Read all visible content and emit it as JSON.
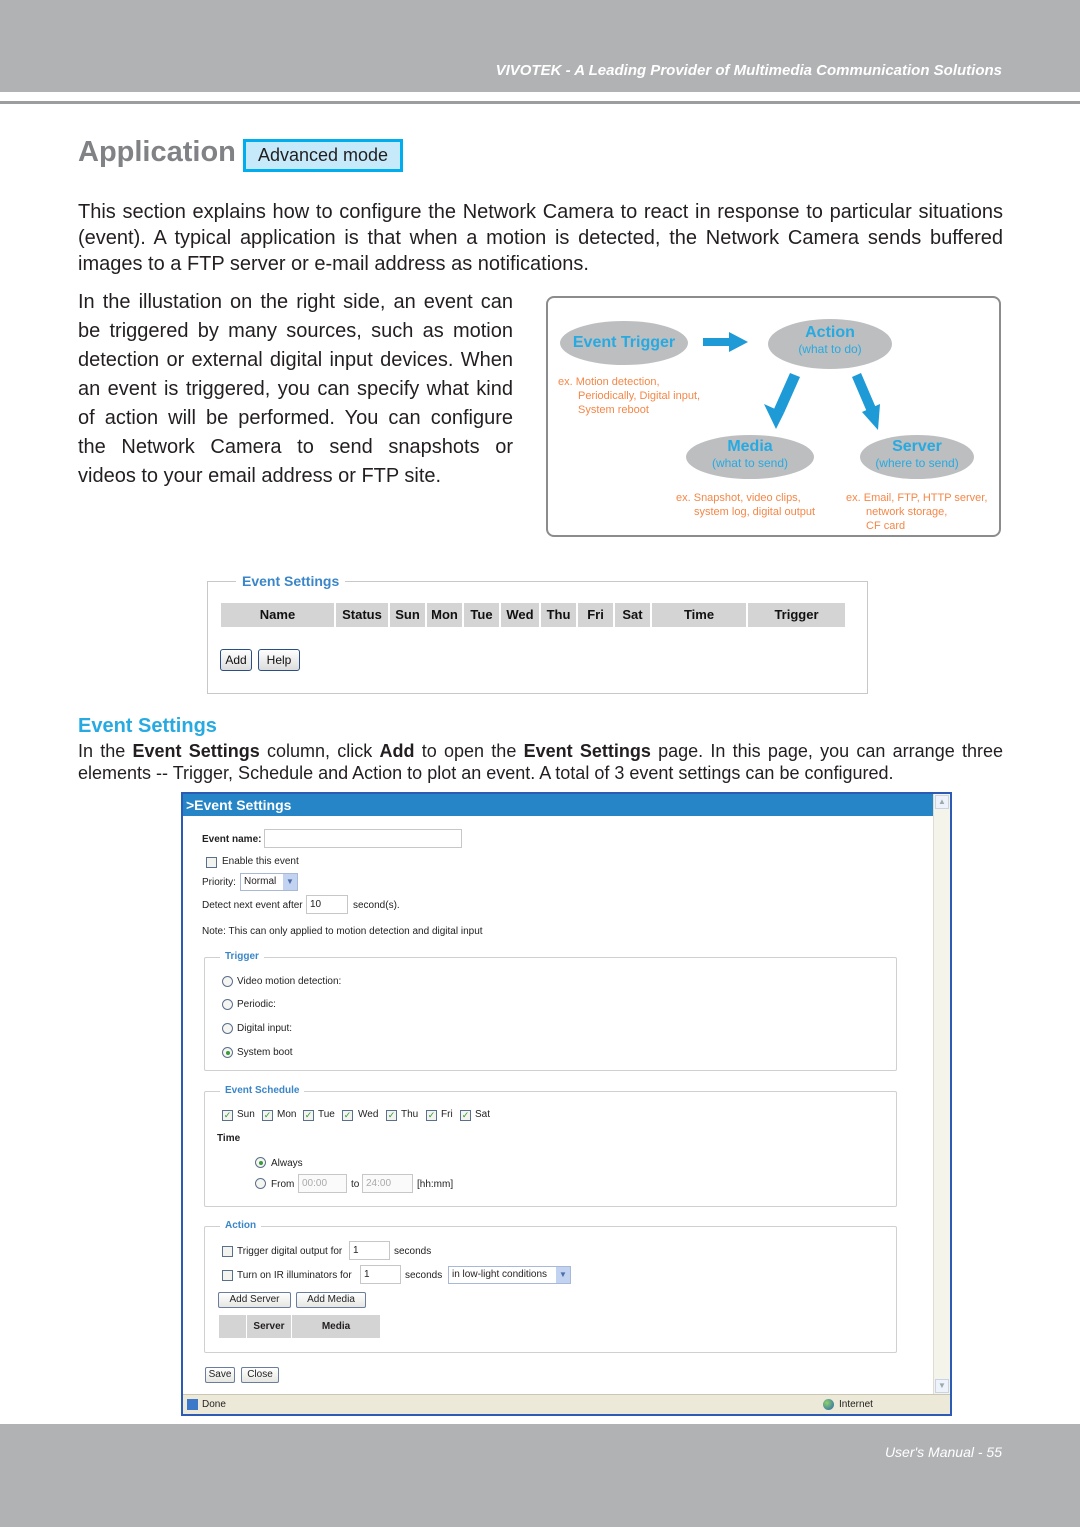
{
  "header": {
    "tagline": "VIVOTEK - A Leading Provider of Multimedia Communication Solutions"
  },
  "page": {
    "title": "Application",
    "badge": "Advanced mode",
    "intro": "This section explains how to configure the Network Camera to react in response to particular situations (event). A typical application is that when a motion is detected, the Network Camera sends buffered images to a FTP server or e-mail address as notifications.",
    "illustration_text": "In the illustation on the right side, an event can be triggered by many sources, such as motion detection or external digital input devices. When an event is triggered, you can specify what kind of action will be performed. You can configure the Network Camera to send snapshots or videos to your email address or FTP site."
  },
  "diagram": {
    "trigger": {
      "title": "Event Trigger",
      "examples": [
        "ex. Motion detection,",
        "Periodically, Digital input,",
        "System reboot"
      ]
    },
    "action": {
      "title": "Action",
      "subtitle": "(what to do)"
    },
    "media": {
      "title": "Media",
      "subtitle": "(what to send)",
      "examples": [
        "ex. Snapshot, video clips,",
        "system log, digital output"
      ]
    },
    "server": {
      "title": "Server",
      "subtitle": "(where to send)",
      "examples": [
        "ex. Email, FTP, HTTP server,",
        "network storage,",
        "CF card"
      ]
    },
    "colors": {
      "title": "#27aae1",
      "example": "#f58747",
      "ellipse": "#bcbec0"
    }
  },
  "event_settings_panel": {
    "legend": "Event Settings",
    "columns": [
      "Name",
      "Status",
      "Sun",
      "Mon",
      "Tue",
      "Wed",
      "Thu",
      "Fri",
      "Sat",
      "Time",
      "Trigger"
    ],
    "add_label": "Add",
    "help_label": "Help"
  },
  "section": {
    "heading": "Event Settings",
    "p_prefix": "In the ",
    "p_b1": "Event Settings",
    "p_mid1": " column, click ",
    "p_b2": "Add",
    "p_mid2": " to open the ",
    "p_b3": "Event Settings",
    "p_suffix": " page. In this page, you can arrange three elements -- Trigger, Schedule and Action to plot an event. A total of 3 event settings can be configured."
  },
  "window": {
    "title": ">Event Settings",
    "event_name_label": "Event name:",
    "event_name_value": "",
    "enable_label": "Enable this event",
    "enable_checked": false,
    "priority_label": "Priority:",
    "priority_value": "Normal",
    "detect_label": "Detect next event after",
    "detect_value": "10",
    "detect_unit": "second(s).",
    "note": "Note: This can only applied to motion detection and digital input",
    "trigger": {
      "legend": "Trigger",
      "options": [
        {
          "label": "Video motion detection:",
          "selected": false
        },
        {
          "label": "Periodic:",
          "selected": false
        },
        {
          "label": "Digital input:",
          "selected": false
        },
        {
          "label": "System boot",
          "selected": true
        }
      ]
    },
    "schedule": {
      "legend": "Event Schedule",
      "days": [
        {
          "label": "Sun",
          "checked": true
        },
        {
          "label": "Mon",
          "checked": true
        },
        {
          "label": "Tue",
          "checked": true
        },
        {
          "label": "Wed",
          "checked": true
        },
        {
          "label": "Thu",
          "checked": true
        },
        {
          "label": "Fri",
          "checked": true
        },
        {
          "label": "Sat",
          "checked": true
        }
      ],
      "time_label": "Time",
      "always_label": "Always",
      "always_selected": true,
      "from_label": "From",
      "from_value": "00:00",
      "to_label": "to",
      "to_value": "24:00",
      "format_hint": "[hh:mm]"
    },
    "action": {
      "legend": "Action",
      "digital_output_label": "Trigger digital output for",
      "digital_output_value": "1",
      "digital_output_unit": "seconds",
      "ir_label": "Turn on IR illuminators for",
      "ir_value": "1",
      "ir_unit": "seconds",
      "ir_condition": "in low-light conditions",
      "add_server_label": "Add Server",
      "add_media_label": "Add Media",
      "columns": [
        "",
        "Server",
        "Media"
      ]
    },
    "save_label": "Save",
    "close_label": "Close",
    "status_text": "Done",
    "zone_text": "Internet"
  },
  "footer": {
    "page_label": "User's Manual - 55"
  }
}
